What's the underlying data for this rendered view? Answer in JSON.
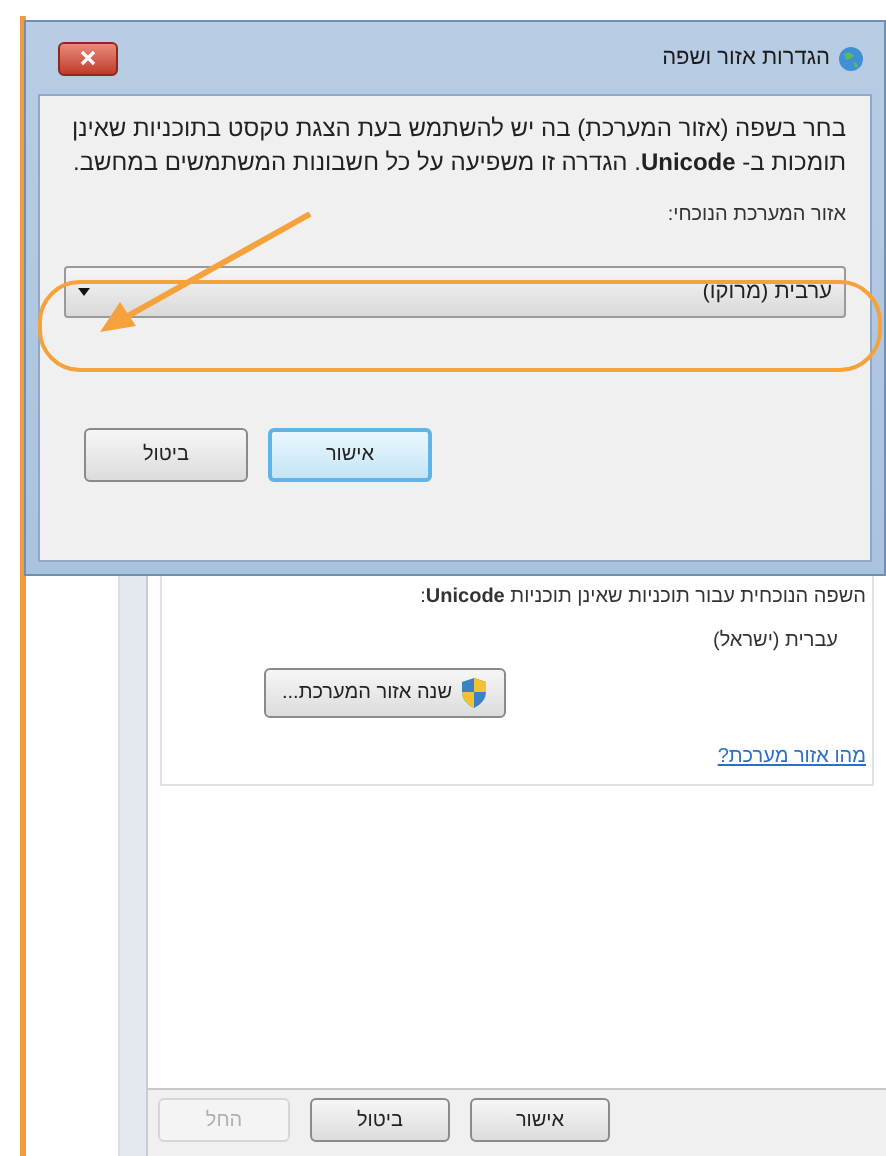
{
  "dialog": {
    "title": "הגדרות אזור ושפה",
    "description": "בחר בשפה (אזור המערכת) בה יש להשתמש בעת הצגת טקסט בתוכניות שאינן תומכות ב- **Unicode**. הגדרה זו משפיעה על כל חשבונות המשתמשים במחשב.",
    "field_label": "אזור המערכת הנוכחי:",
    "dropdown": {
      "value": "ערבית (מרוקו)"
    },
    "buttons": [
      {
        "label": "אישור",
        "default": true
      },
      {
        "label": "ביטול",
        "default": false
      }
    ]
  },
  "background_window": {
    "heading": "השפה הנוכחית עבור תוכניות שאינן תוכניות **Unicode**:",
    "current_language": "עברית (ישראל)",
    "change_button": "שנה אזור המערכת...",
    "link": "מהו אזור מערכת?",
    "buttons": [
      {
        "label": "אישור",
        "disabled": false
      },
      {
        "label": "ביטול",
        "disabled": false
      },
      {
        "label": "החל",
        "disabled": true
      }
    ]
  }
}
